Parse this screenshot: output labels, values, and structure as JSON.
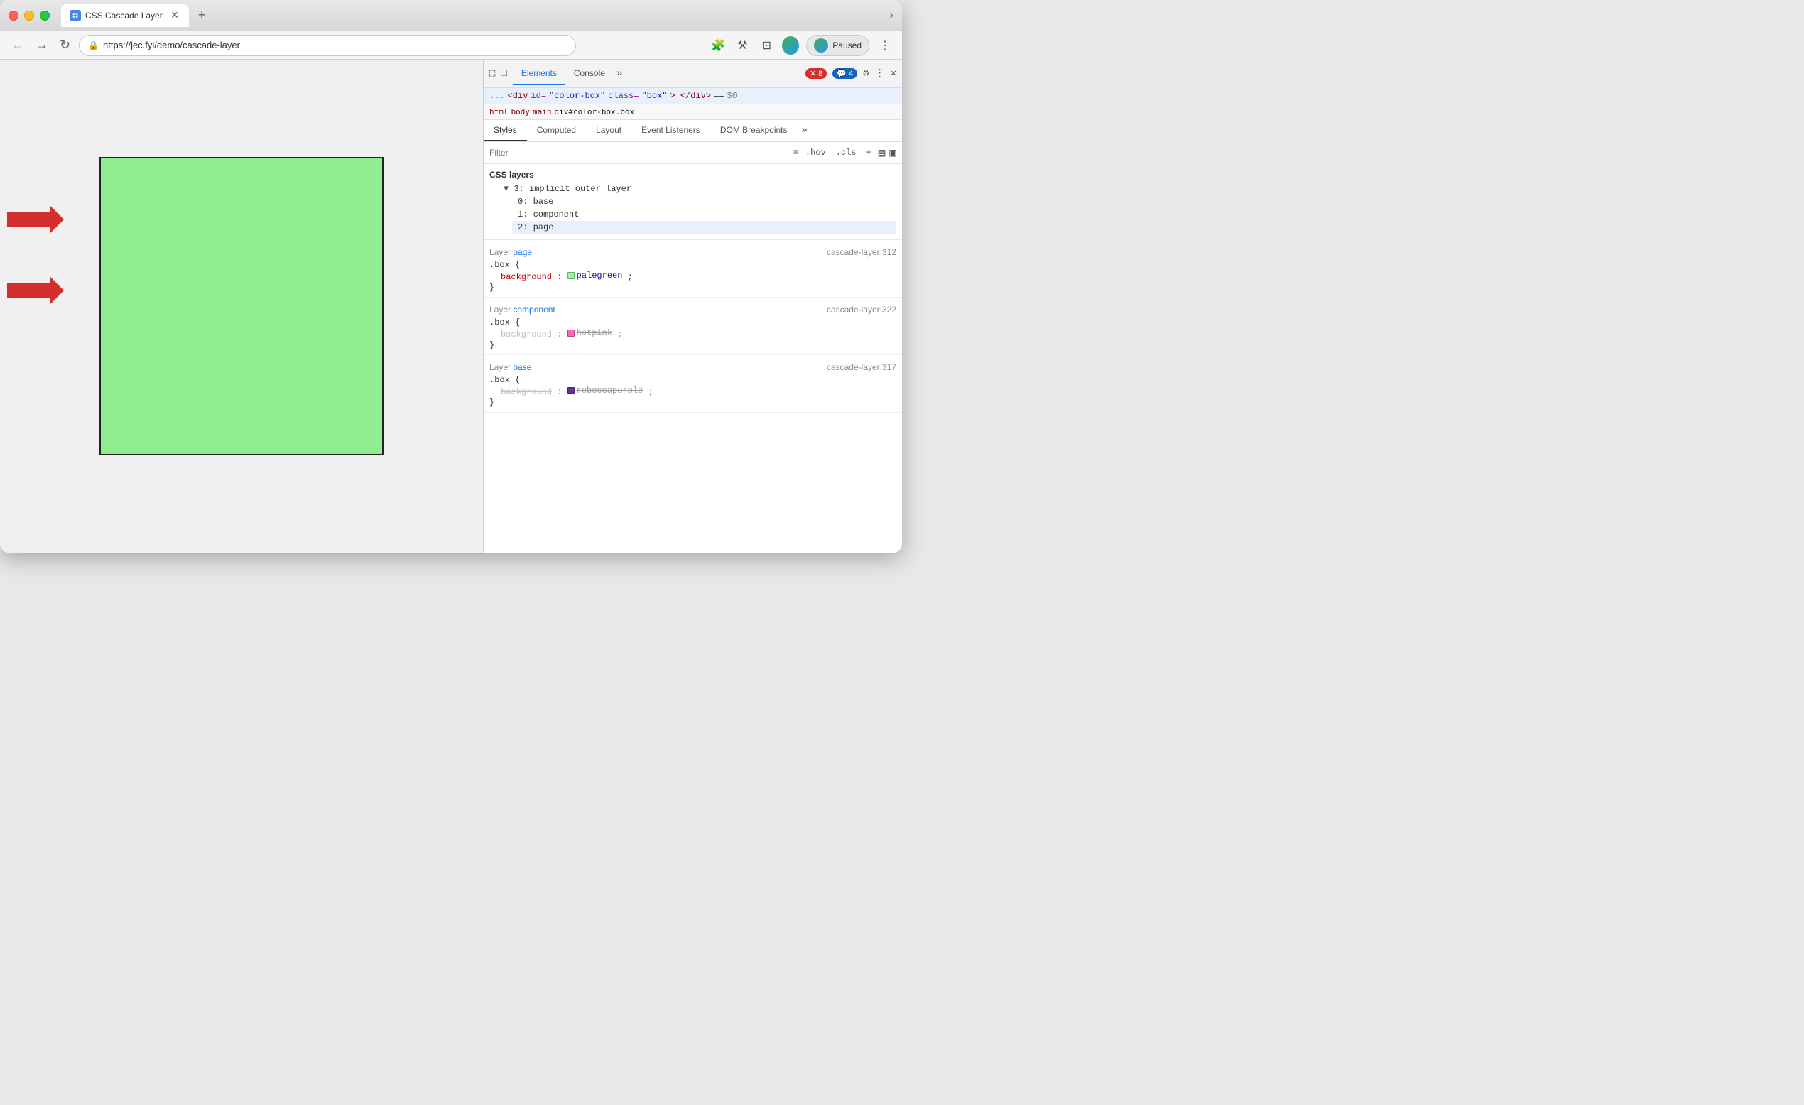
{
  "browser": {
    "tab_title": "CSS Cascade Layer",
    "url": "https://jec.fyi/demo/cascade-layer",
    "paused_label": "Paused"
  },
  "devtools": {
    "tabs": [
      "Elements",
      "Console"
    ],
    "active_tab": "Elements",
    "error_count": "8",
    "warning_count": "4",
    "breadcrumb": {
      "items": [
        "html",
        "body",
        "main",
        "div#color-box.box"
      ]
    },
    "dom_line": "<div id=\"color-box\" class=\"box\"> </div> == $0",
    "subtabs": [
      "Styles",
      "Computed",
      "Layout",
      "Event Listeners",
      "DOM Breakpoints"
    ],
    "active_subtab": "Styles",
    "filter_placeholder": "Filter",
    "filter_actions": [
      ":hov",
      ".cls",
      "+"
    ],
    "css_layers": {
      "header": "CSS layers",
      "tree": {
        "root": "3: implicit outer layer",
        "children": [
          "0: base",
          "1: component",
          "2: page"
        ]
      }
    },
    "style_rules": [
      {
        "layer_label": "Layer",
        "layer_name": "page",
        "file": "cascade-layer:312",
        "selector": ".box",
        "properties": [
          {
            "name": "background",
            "value": "palegreen",
            "color": "#98FB98",
            "strikethrough": false
          }
        ]
      },
      {
        "layer_label": "Layer",
        "layer_name": "component",
        "file": "cascade-layer:322",
        "selector": ".box",
        "properties": [
          {
            "name": "background",
            "value": "hotpink",
            "color": "#FF69B4",
            "strikethrough": true
          }
        ]
      },
      {
        "layer_label": "Layer",
        "layer_name": "base",
        "file": "cascade-layer:317",
        "selector": ".box",
        "properties": [
          {
            "name": "background",
            "value": "rebeccapurple",
            "color": "#663399",
            "strikethrough": true
          }
        ]
      }
    ]
  }
}
